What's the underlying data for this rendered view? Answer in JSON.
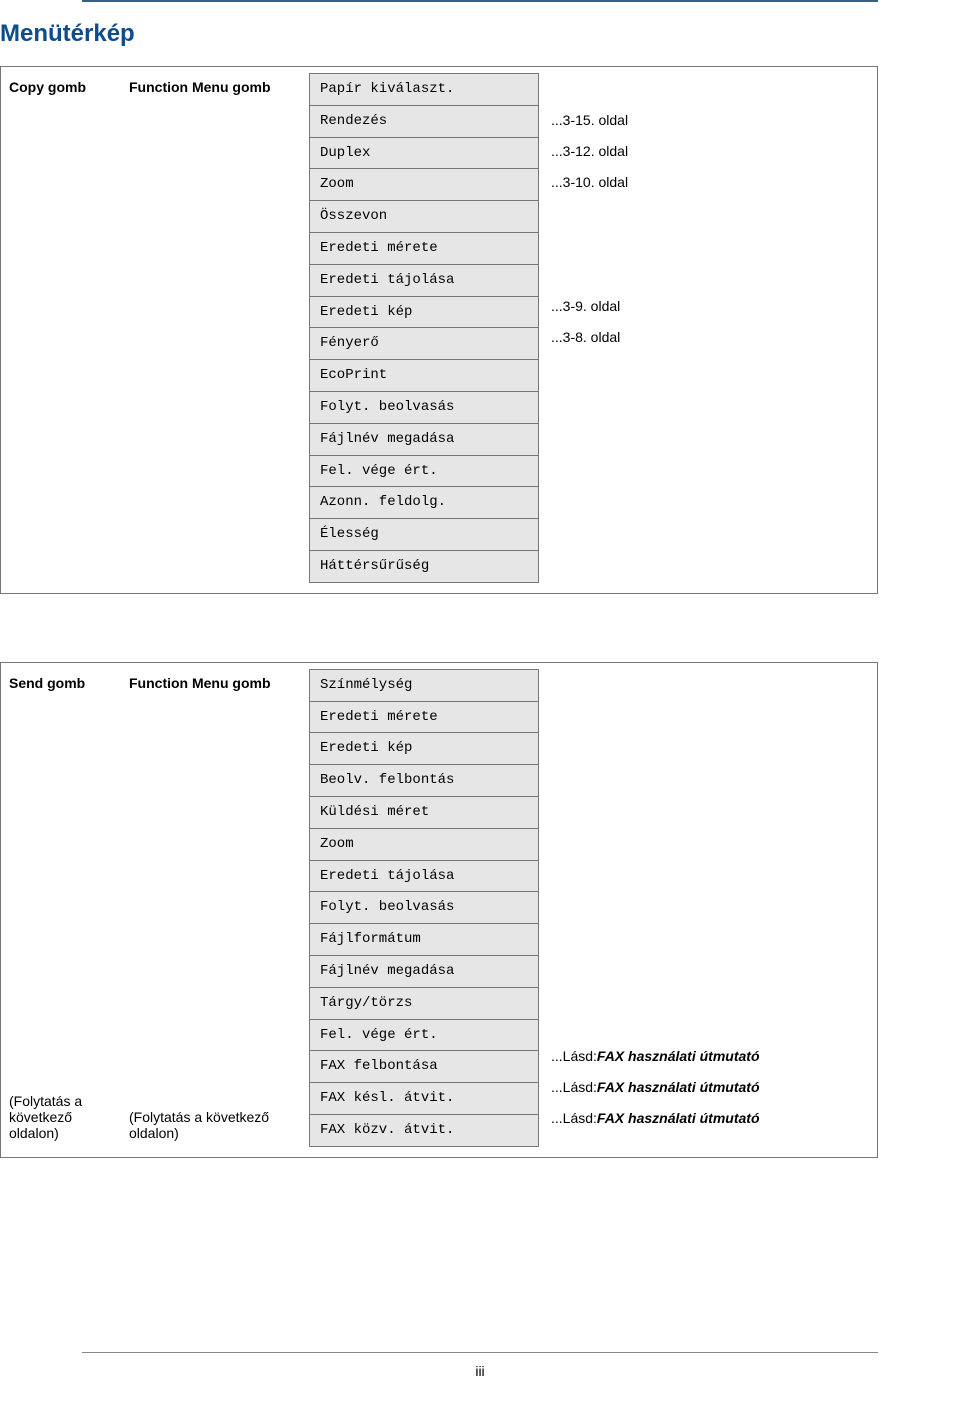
{
  "heading": "Menütérkép",
  "page_number": "iii",
  "block1": {
    "col_a": "Copy gomb",
    "col_b": "Function Menu gomb",
    "items": [
      {
        "label": "Papír kiválaszt.",
        "page": ""
      },
      {
        "label": "Rendezés",
        "page": "...3-15. oldal"
      },
      {
        "label": "Duplex",
        "page": "...3-12. oldal"
      },
      {
        "label": "Zoom",
        "page": "...3-10. oldal"
      },
      {
        "label": "Összevon",
        "page": ""
      },
      {
        "label": "Eredeti mérete",
        "page": ""
      },
      {
        "label": "Eredeti tájolása",
        "page": ""
      },
      {
        "label": "Eredeti kép",
        "page": "...3-9. oldal"
      },
      {
        "label": "Fényerő",
        "page": "...3-8. oldal"
      },
      {
        "label": "EcoPrint",
        "page": ""
      },
      {
        "label": "Folyt. beolvasás",
        "page": ""
      },
      {
        "label": "Fájlnév megadása",
        "page": ""
      },
      {
        "label": "Fel. vége ért.",
        "page": ""
      },
      {
        "label": "Azonn. feldolg.",
        "page": ""
      },
      {
        "label": "Élesség",
        "page": ""
      },
      {
        "label": "Háttérsűrűség",
        "page": ""
      }
    ]
  },
  "block2": {
    "col_a_top": "Send gomb",
    "col_b_top": "Function Menu gomb",
    "col_a_bottom": "(Folytatás a következő oldalon)",
    "col_b_bottom": "(Folytatás a következő oldalon)",
    "ref_label": "FAX használati útmutató",
    "ref_prefix": "...Lásd: ",
    "items": [
      {
        "label": "Színmélység",
        "page": ""
      },
      {
        "label": "Eredeti mérete",
        "page": ""
      },
      {
        "label": "Eredeti kép",
        "page": ""
      },
      {
        "label": "Beolv. felbontás",
        "page": ""
      },
      {
        "label": "Küldési méret",
        "page": ""
      },
      {
        "label": "Zoom",
        "page": ""
      },
      {
        "label": "Eredeti tájolása",
        "page": ""
      },
      {
        "label": "Folyt. beolvasás",
        "page": ""
      },
      {
        "label": "Fájlformátum",
        "page": ""
      },
      {
        "label": "Fájlnév megadása",
        "page": ""
      },
      {
        "label": "Tárgy/törzs",
        "page": ""
      },
      {
        "label": "Fel. vége ért.",
        "page": ""
      },
      {
        "label": "FAX felbontása",
        "ref": true
      },
      {
        "label": "FAX késl. átvit.",
        "ref": true
      },
      {
        "label": "FAX közv. átvit.",
        "ref": true
      }
    ]
  }
}
